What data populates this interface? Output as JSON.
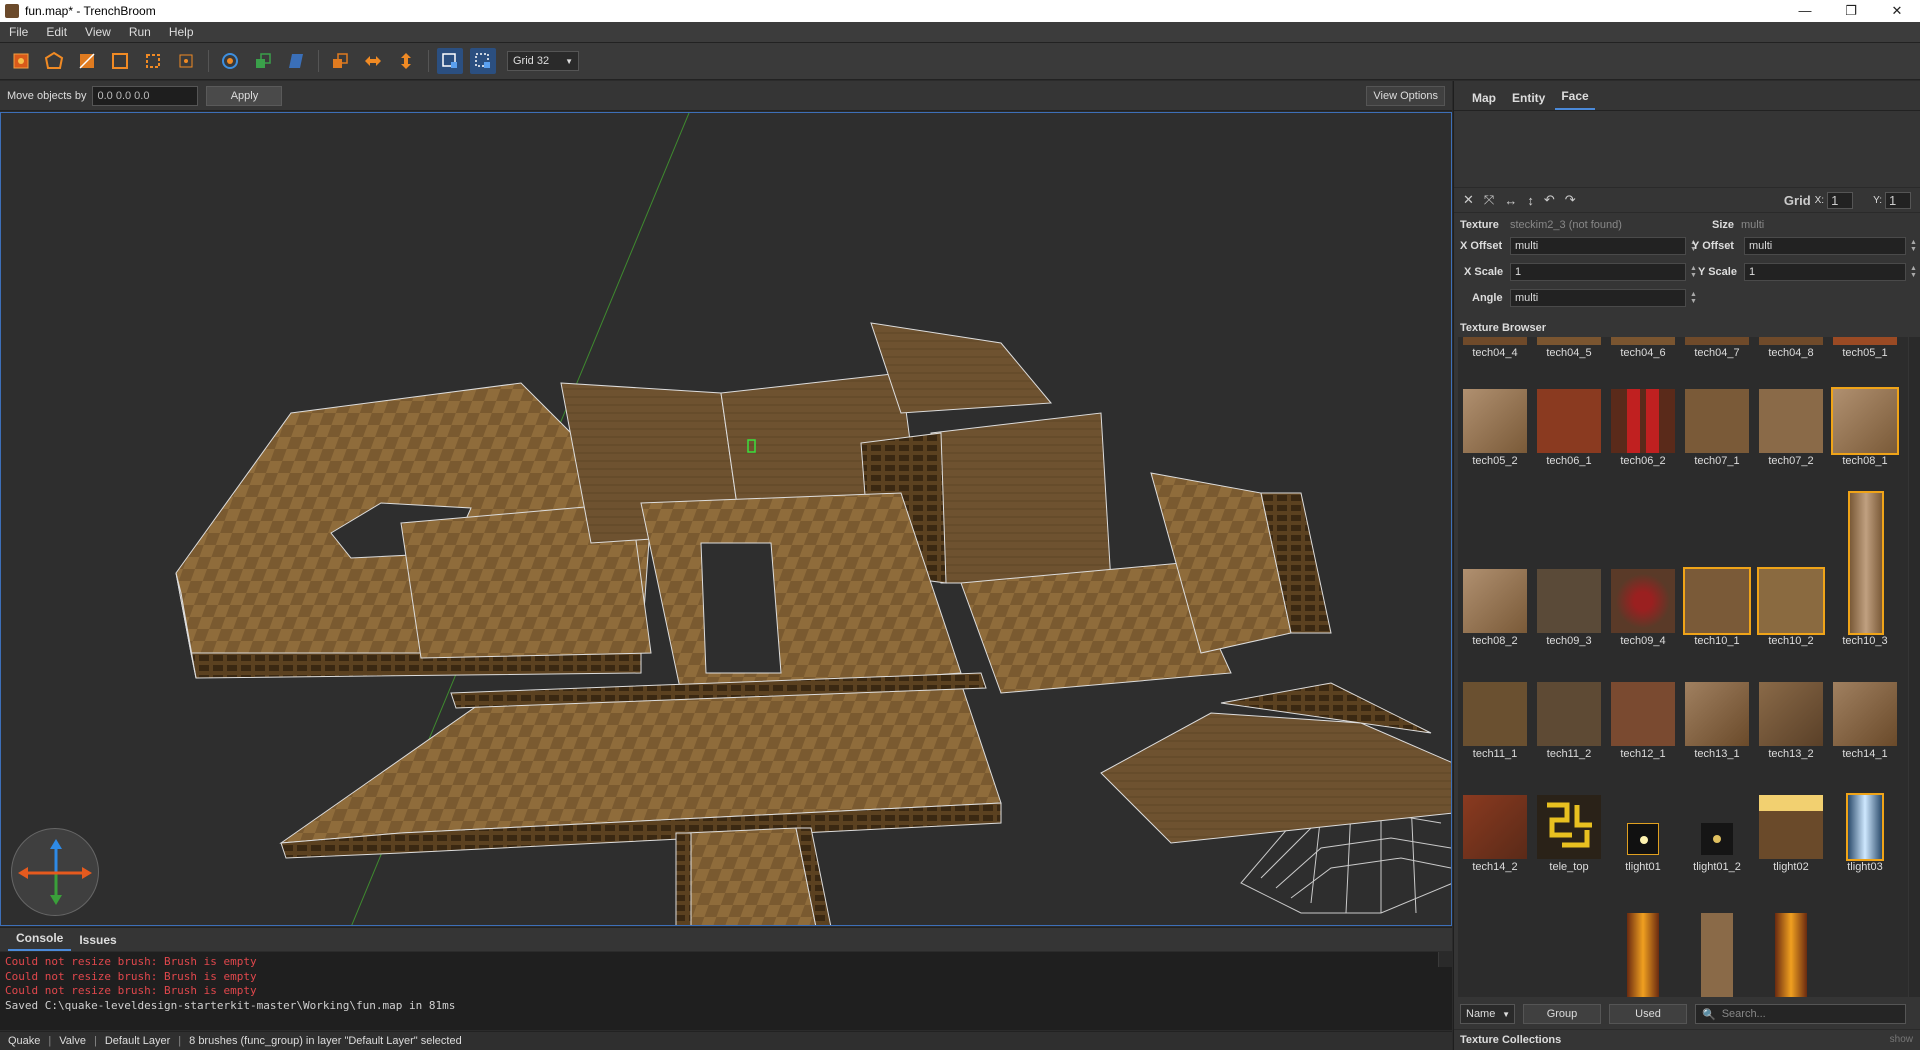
{
  "window": {
    "title": "fun.map* - TrenchBroom",
    "controls": [
      "—",
      "❐",
      "✕"
    ]
  },
  "menu": [
    "File",
    "Edit",
    "View",
    "Run",
    "Help"
  ],
  "toolbar": {
    "grid": "Grid 32"
  },
  "movebar": {
    "label": "Move objects by",
    "value": "0.0 0.0 0.0",
    "apply": "Apply",
    "view_options": "View Options"
  },
  "console": {
    "tabs": [
      "Console",
      "Issues"
    ],
    "lines": [
      "Could not resize brush: Brush is empty",
      "Could not resize brush: Brush is empty",
      "Could not resize brush: Brush is empty",
      "Saved C:\\quake-leveldesign-starterkit-master\\Working\\fun.map in 81ms"
    ],
    "colors": {
      "error": "#e0474c",
      "info": "#cfcfcf"
    }
  },
  "status": {
    "game": "Quake",
    "format": "Valve",
    "layer": "Default Layer",
    "selection": "8 brushes (func_group) in layer \"Default Layer\" selected"
  },
  "panel": {
    "tabs": [
      "Map",
      "Entity",
      "Face"
    ],
    "face": {
      "grid_label": "Grid",
      "grid_x_label": "X:",
      "grid_x": "1",
      "grid_y_label": "Y:",
      "grid_y": "1",
      "texture_label": "Texture",
      "texture_value": "steckim2_3 (not found)",
      "size_label": "Size",
      "size_value": "multi",
      "x_offset_label": "X Offset",
      "x_offset": "multi",
      "y_offset_label": "Y Offset",
      "y_offset": "multi",
      "x_scale_label": "X Scale",
      "x_scale": "1",
      "y_scale_label": "Y Scale",
      "y_scale": "1",
      "angle_label": "Angle",
      "angle": "multi"
    },
    "texture_browser": {
      "title": "Texture Browser",
      "row0": [
        "tech04_4",
        "tech04_5",
        "tech04_6",
        "tech04_7",
        "tech04_8",
        "tech05_1"
      ],
      "row1": [
        "tech05_2",
        "tech06_1",
        "tech06_2",
        "tech07_1",
        "tech07_2",
        "tech08_1"
      ],
      "row2": [
        "tech08_2",
        "tech09_3",
        "tech09_4",
        "tech10_1",
        "tech10_2",
        "tech10_3"
      ],
      "row3": [
        "tech11_1",
        "tech11_2",
        "tech12_1",
        "tech13_1",
        "tech13_2",
        "tech14_1"
      ],
      "row4": [
        "tech14_2",
        "tele_top",
        "tlight01",
        "tlight01_2",
        "tlight02",
        "tlight03"
      ],
      "sort": "Name",
      "group": "Group",
      "used": "Used",
      "search_placeholder": "Search..."
    },
    "collections": {
      "title": "Texture Collections",
      "show": "show"
    }
  }
}
